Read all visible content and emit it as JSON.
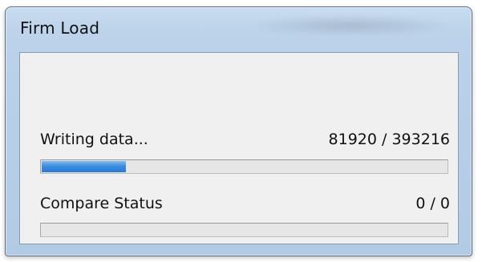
{
  "window": {
    "title": "Firm Load"
  },
  "write": {
    "label": "Writing data...",
    "value": "81920 / 393216",
    "progress_fraction": 0.2083
  },
  "compare": {
    "label": "Compare Status",
    "value": "0 / 0",
    "progress_fraction": 0
  },
  "colors": {
    "progress_fill": "#3c8de0",
    "window_frame": "#b7cfe7",
    "client_bg": "#f0f0f0"
  }
}
